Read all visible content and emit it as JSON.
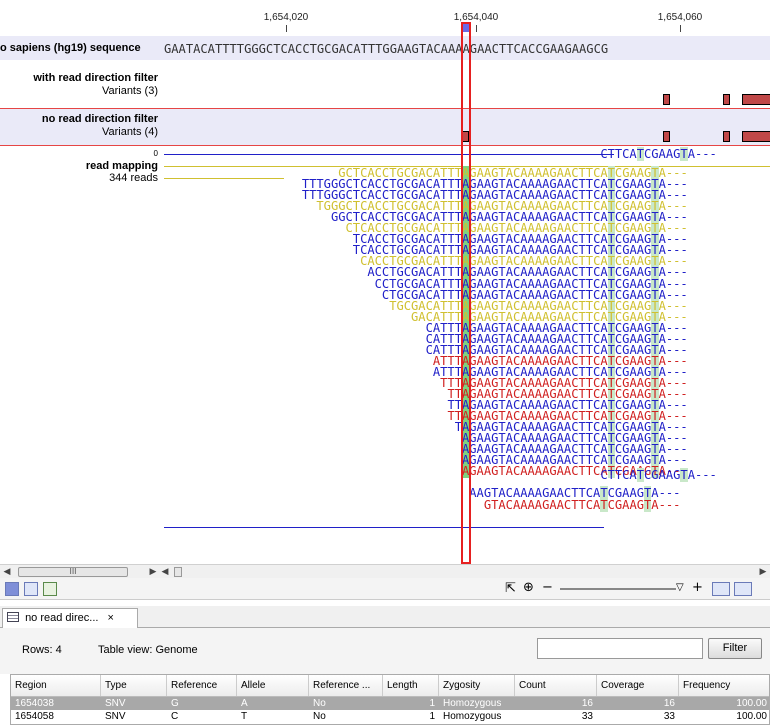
{
  "ruler": {
    "ticks": [
      "1,654,020",
      "1,654,040",
      "1,654,060"
    ]
  },
  "tracks": {
    "sequence": {
      "name": "o sapiens (hg19) sequence",
      "bases": "GAATACATTTTGGGCTCACCTGCGACATTTGGAAGTACAAAAGAACTTCACCGAAGAAGCG"
    },
    "filter1": {
      "title": "with read direction filter",
      "subtitle": "Variants (3)"
    },
    "filter2": {
      "title": "no read direction filter",
      "subtitle": "Variants (4)"
    },
    "mapping": {
      "axis_zero": "0",
      "title": "read mapping",
      "reads": "344 reads"
    }
  },
  "reads": [
    {
      "color": "blue",
      "text": "CTTCATCGAAGTA---"
    },
    {
      "color": "yellow",
      "text": "GCTCACCTGCGACATTTAGAAGTACAAAAGAACTTCATCGAAGTA---"
    },
    {
      "color": "blue",
      "text": "TTTGGGCTCACCTGCGACATTTAGAAGTACAAAAGAACTTCATCGAAGTA---"
    },
    {
      "color": "blue",
      "text": "TTTGGGCTCACCTGCGACATTTAGAAGTACAAAAGAACTTCATCGAAGTA---"
    },
    {
      "color": "yellow",
      "text": "TGGGCTCACCTGCGACATTTAGAAGTACAAAAGAACTTCATCGAAGTA---"
    },
    {
      "color": "blue",
      "text": "GGCTCACCTGCGACATTTAGAAGTACAAAAGAACTTCATCGAAGTA---"
    },
    {
      "color": "yellow",
      "text": "CTCACCTGCGACATTTAGAAGTACAAAAGAACTTCATCGAAGTA---"
    },
    {
      "color": "blue",
      "text": "TCACCTGCGACATTTAGAAGTACAAAAGAACTTCATCGAAGTA---"
    },
    {
      "color": "blue",
      "text": "TCACCTGCGACATTTAGAAGTACAAAAGAACTTCATCGAAGTA---"
    },
    {
      "color": "yellow",
      "text": "CACCTGCGACATTTAGAAGTACAAAAGAACTTCATCGAAGTA---"
    },
    {
      "color": "blue",
      "text": "ACCTGCGACATTTAGAAGTACAAAAGAACTTCATCGAAGTA---"
    },
    {
      "color": "blue",
      "text": "CCTGCGACATTTAGAAGTACAAAAGAACTTCATCGAAGTA---"
    },
    {
      "color": "blue",
      "text": "CTGCGACATTTAGAAGTACAAAAGAACTTCATCGAAGTA---"
    },
    {
      "color": "yellow",
      "text": "TGCGACATTTAGAAGTACAAAAGAACTTCATCGAAGTA---"
    },
    {
      "color": "yellow",
      "text": "GACATTTAGAAGTACAAAAGAACTTCATCGAAGTA---"
    },
    {
      "color": "blue",
      "text": "CATTTAGAAGTACAAAAGAACTTCATCGAAGTA---"
    },
    {
      "color": "blue",
      "text": "CATTTAGAAGTACAAAAGAACTTCATCGAAGTA---"
    },
    {
      "color": "blue",
      "text": "CATTTAGAAGTACAAAAGAACTTCATCGAAGTA---"
    },
    {
      "color": "red",
      "text": "ATTTAGAAGTACAAAAGAACTTCATCGAAGTA---"
    },
    {
      "color": "blue",
      "text": "ATTTAGAAGTACAAAAGAACTTCATCGAAGTA---"
    },
    {
      "color": "red",
      "text": "TTTAGAAGTACAAAAGAACTTCATCGAAGTA---"
    },
    {
      "color": "red",
      "text": "TTAGAAGTACAAAAGAACTTCATCGAAGTA---"
    },
    {
      "color": "blue",
      "text": "TTAGAAGTACAAAAGAACTTCATCGAAGTA---"
    },
    {
      "color": "red",
      "text": "TTAGAAGTACAAAAGAACTTCATCGAAGTA---"
    },
    {
      "color": "blue",
      "text": "TAGAAGTACAAAAGAACTTCATCGAAGTA---"
    },
    {
      "color": "blue",
      "text": "AGAAGTACAAAAGAACTTCATCGAAGTA---"
    },
    {
      "color": "blue",
      "text": "AGAAGTACAAAAGAACTTCATCGAAGTA---"
    },
    {
      "color": "blue",
      "text": "AGAAGTACAAAAGAACTTCATCGAAGTA---"
    },
    {
      "color": "red",
      "text": "AGAAGTACAAAAGAACTTCATCGAAGTA---"
    },
    {
      "color": "blue",
      "text": "CTTCATCGAAGTA---"
    },
    {
      "color": "blue",
      "text": "AAGTACAAAAGAACTTCATCGAAGTA---"
    },
    {
      "color": "red",
      "text": "GTACAAAAGAACTTCATCGAAGTA---"
    }
  ],
  "scrollbar": {
    "thumb_label": "III"
  },
  "table_tab": {
    "label": "no read direc...",
    "close": "×"
  },
  "table": {
    "rows_label": "Rows: 4",
    "view_label": "Table view: Genome",
    "filter_placeholder": "",
    "filter_button": "Filter",
    "columns": [
      "Region",
      "Type",
      "Reference",
      "Allele",
      "Reference ...",
      "Length",
      "Zygosity",
      "Count",
      "Coverage",
      "Frequency"
    ],
    "rows": [
      [
        "1654038",
        "SNV",
        "G",
        "A",
        "No",
        "1",
        "Homozygous",
        "16",
        "16",
        "100.00"
      ],
      [
        "1654058",
        "SNV",
        "C",
        "T",
        "No",
        "1",
        "Homozygous",
        "33",
        "33",
        "100.00"
      ]
    ]
  },
  "colors": {
    "read_blue": "#2020c8",
    "read_yellow": "#d0c030",
    "read_red": "#d02020",
    "highlight": "#e62020",
    "variant": "#c04848"
  }
}
